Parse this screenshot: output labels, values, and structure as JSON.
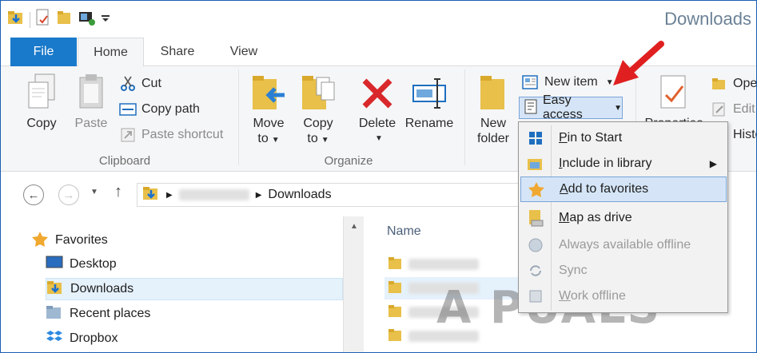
{
  "window": {
    "title": "Downloads"
  },
  "tabs": [
    {
      "label": "File"
    },
    {
      "label": "Home"
    },
    {
      "label": "Share"
    },
    {
      "label": "View"
    }
  ],
  "ribbon": {
    "clipboard": {
      "copy": "Copy",
      "paste": "Paste",
      "cut": "Cut",
      "copy_path": "Copy path",
      "paste_shortcut": "Paste shortcut",
      "group_label": "Clipboard"
    },
    "organize": {
      "move_to_line1": "Move",
      "move_to_line2": "to",
      "copy_to_line1": "Copy",
      "copy_to_line2": "to",
      "delete": "Delete",
      "rename": "Rename",
      "group_label": "Organize"
    },
    "new": {
      "new_folder_line1": "New",
      "new_folder_line2": "folder",
      "new_item": "New item",
      "easy_access": "Easy access"
    },
    "open": {
      "properties": "Properties",
      "open": "Ope",
      "edit": "Edit",
      "history": "Histo"
    }
  },
  "address": {
    "current": "Downloads"
  },
  "navpane": {
    "favorites": "Favorites",
    "items": [
      {
        "label": "Desktop"
      },
      {
        "label": "Downloads"
      },
      {
        "label": "Recent places"
      },
      {
        "label": "Dropbox"
      }
    ]
  },
  "filelist": {
    "column_name": "Name"
  },
  "menu": {
    "items": [
      {
        "label": "Pin to Start",
        "accel": "P",
        "rest": "in to Start"
      },
      {
        "label": "Include in library",
        "accel": "I",
        "rest": "nclude in library"
      },
      {
        "label": "Add to favorites",
        "accel": "A",
        "rest": "dd to favorites"
      },
      {
        "label": "Map as drive",
        "accel": "M",
        "rest": "ap as drive"
      },
      {
        "label": "Always available offline",
        "accel": "",
        "rest": "Always available offline"
      },
      {
        "label": "Sync",
        "accel": "",
        "rest": "Sync"
      },
      {
        "label": "Work offline",
        "accel": "W",
        "rest": "ork offline"
      }
    ]
  },
  "watermark": {
    "text": "A PUALS"
  },
  "colors": {
    "file_tab": "#1979ca",
    "ribbon_bg": "#f5f6f7",
    "highlight": "#d5e5f7",
    "arrow": "#e02020"
  }
}
